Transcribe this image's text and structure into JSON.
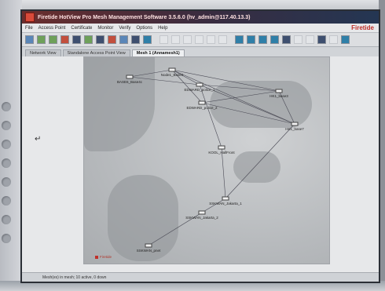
{
  "window": {
    "title": "Firetide HotView Pro Mesh Management Software  3.5.6.0 (hv_admin@117.40.13.3)",
    "brand": "Firetide"
  },
  "menu": [
    "File",
    "Access Point",
    "Certificate",
    "Monitor",
    "Verify",
    "Options",
    "Help"
  ],
  "tabs": [
    {
      "label": "Network View",
      "active": false
    },
    {
      "label": "Standalone Access Point View",
      "active": false
    },
    {
      "label": "Mesh 1 (Annamesh1)",
      "active": true
    }
  ],
  "nodes": [
    {
      "id": "n1",
      "label": "Node1_Base4"
    },
    {
      "id": "n2",
      "label": "BASE6_Base4c"
    },
    {
      "id": "n3",
      "label": "EDWARD_police_1"
    },
    {
      "id": "n4",
      "label": "EDWARD_police_2"
    },
    {
      "id": "n5",
      "label": "HK1_base3"
    },
    {
      "id": "n6",
      "label": "HK1_base7"
    },
    {
      "id": "n7",
      "label": "KOOL_HallFront"
    },
    {
      "id": "n8",
      "label": "SSKWAN_Jakarta_1"
    },
    {
      "id": "n9",
      "label": "SSKWAN_Jakarta_2"
    },
    {
      "id": "n10",
      "label": "SSKWAN_pnet"
    }
  ],
  "map_legend": "Firetide",
  "status": "Mesh(es) in mesh; 10 active, 0 down"
}
